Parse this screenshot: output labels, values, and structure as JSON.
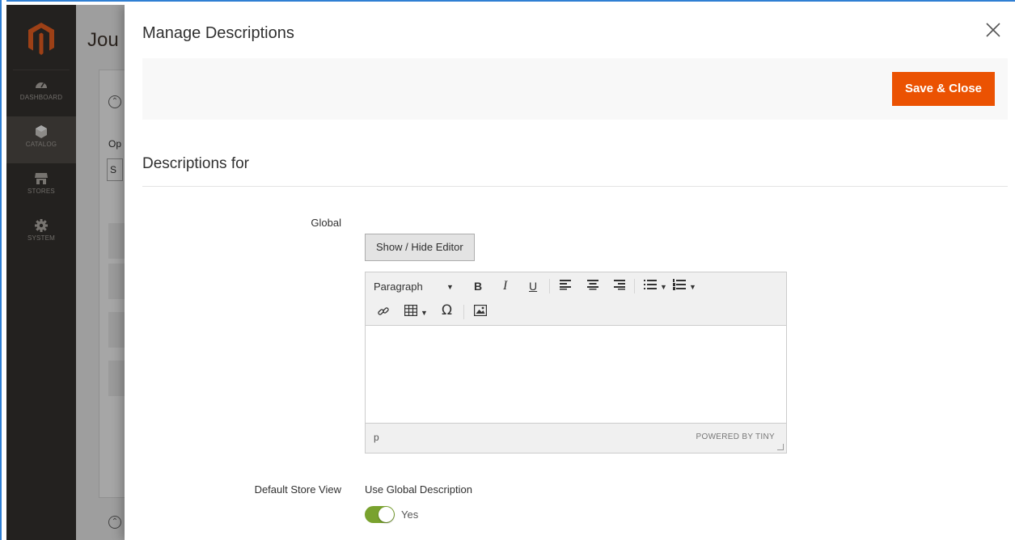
{
  "sidebar": {
    "items": [
      {
        "label": "DASHBOARD",
        "icon": "speedometer-icon"
      },
      {
        "label": "CATALOG",
        "icon": "cube-icon"
      },
      {
        "label": "STORES",
        "icon": "storefront-icon"
      },
      {
        "label": "SYSTEM",
        "icon": "gear-icon"
      }
    ],
    "active": "CATALOG"
  },
  "background_page": {
    "title_fragment": "Jou",
    "option_label_fragment": "Op",
    "select_fragment": "S"
  },
  "modal": {
    "title": "Manage Descriptions",
    "save_label": "Save & Close",
    "section_title": "Descriptions for",
    "global_label": "Global",
    "show_hide_label": "Show / Hide Editor",
    "editor": {
      "format_select": "Paragraph",
      "status_path": "p",
      "powered_by": "POWERED BY TINY"
    },
    "store_view_label": "Default Store View",
    "use_global_label": "Use Global Description",
    "use_global_value": "Yes",
    "use_global_enabled": true
  },
  "colors": {
    "accent": "#eb5202",
    "sidebar": "#373330",
    "toggle_on": "#79a22e"
  }
}
